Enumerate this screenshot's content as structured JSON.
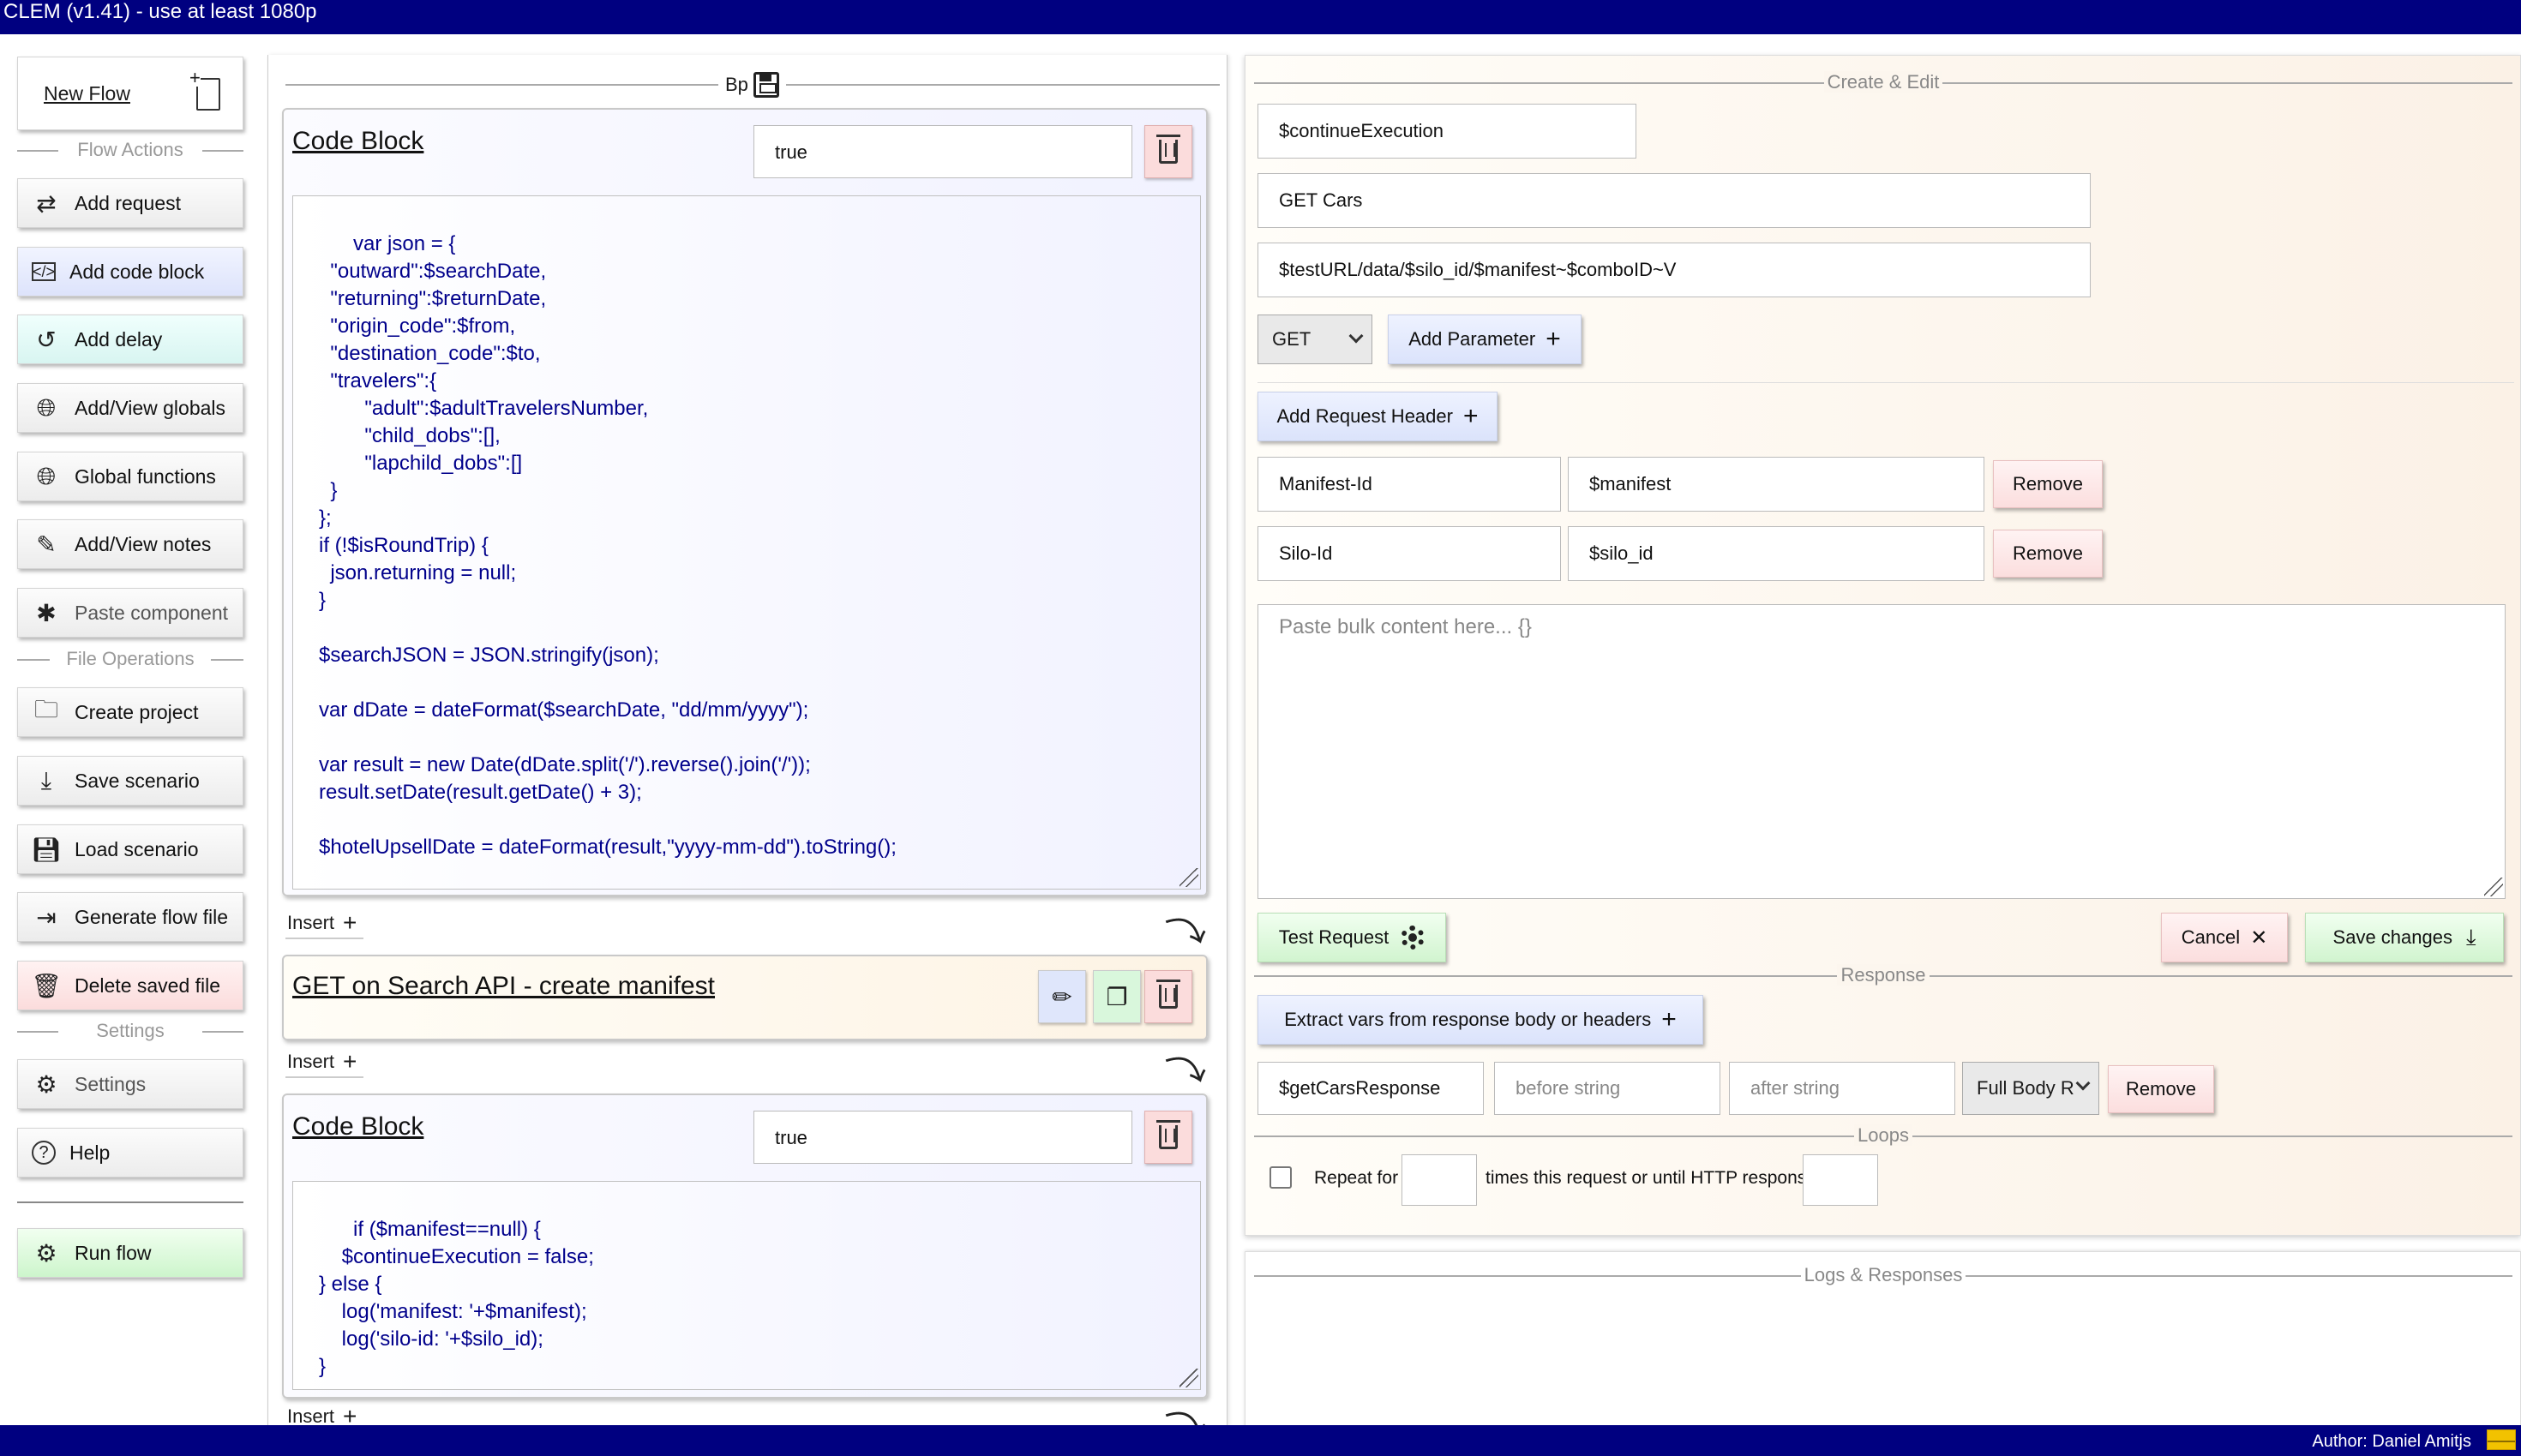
{
  "window": {
    "title": "CLEM (v1.41) - use at least 1080p"
  },
  "footer": {
    "author": "Author: Daniel Amitjs"
  },
  "sidebar": {
    "new_flow": "New Flow",
    "flow_actions_heading": "Flow Actions",
    "file_operations_heading": "File Operations",
    "settings_heading": "Settings",
    "buttons": {
      "add_request": "Add request",
      "add_code_block": "Add code block",
      "add_delay": "Add delay",
      "add_view_globals": "Add/View globals",
      "global_functions": "Global functions",
      "add_view_notes": "Add/View notes",
      "paste_component": "Paste component",
      "create_project": "Create project",
      "save_scenario": "Save scenario",
      "load_scenario": "Load scenario",
      "generate_flow_file": "Generate flow file",
      "delete_saved_file": "Delete saved file",
      "settings": "Settings",
      "help": "Help",
      "run_flow": "Run flow"
    }
  },
  "flow": {
    "header": "Bp",
    "insert_label": "Insert",
    "blocks": [
      {
        "type": "code",
        "title": "Code Block",
        "condition": "true",
        "code": "var json = {\n  \"outward\":$searchDate,\n  \"returning\":$returnDate,\n  \"origin_code\":$from,\n  \"destination_code\":$to,\n  \"travelers\":{\n        \"adult\":$adultTravelersNumber,\n        \"child_dobs\":[],\n        \"lapchild_dobs\":[]\n  }\n};\nif (!$isRoundTrip) {\n  json.returning = null;\n}\n\n$searchJSON = JSON.stringify(json);\n\nvar dDate = dateFormat($searchDate, \"dd/mm/yyyy\");\n\nvar result = new Date(dDate.split('/').reverse().join('/'));\nresult.setDate(result.getDate() + 3);\n\n$hotelUpsellDate = dateFormat(result,\"yyyy-mm-dd\").toString();"
      },
      {
        "type": "request",
        "title": "GET on Search API - create manifest"
      },
      {
        "type": "code",
        "title": "Code Block",
        "condition": "true",
        "code": "if ($manifest==null) {\n    $continueExecution = false;\n} else {\n    log('manifest: '+$manifest);\n    log('silo-id: '+$silo_id);\n}"
      }
    ]
  },
  "editor": {
    "heading": "Create & Edit",
    "condition": "$continueExecution",
    "name": "GET Cars",
    "url": "$testURL/data/$silo_id/$manifest~$comboID~V",
    "method": "GET",
    "add_parameter": "Add Parameter",
    "add_request_header": "Add Request Header",
    "headers": [
      {
        "key": "Manifest-Id",
        "value": "$manifest",
        "remove": "Remove"
      },
      {
        "key": "Silo-Id",
        "value": "$silo_id",
        "remove": "Remove"
      }
    ],
    "bulk_placeholder": "Paste bulk content here... {}",
    "test_request": "Test Request",
    "cancel": "Cancel",
    "save_changes": "Save changes",
    "response_heading": "Response",
    "extract_vars": "Extract vars from response body or headers",
    "extract": {
      "var_name": "$getCarsResponse",
      "before_placeholder": "before string",
      "after_placeholder": "after string",
      "source": "Full Body R",
      "remove": "Remove"
    },
    "loops_heading": "Loops",
    "repeat_for": "Repeat for",
    "repeat_suffix": "times this request or until HTTP response is"
  },
  "logs": {
    "heading": "Logs & Responses"
  }
}
